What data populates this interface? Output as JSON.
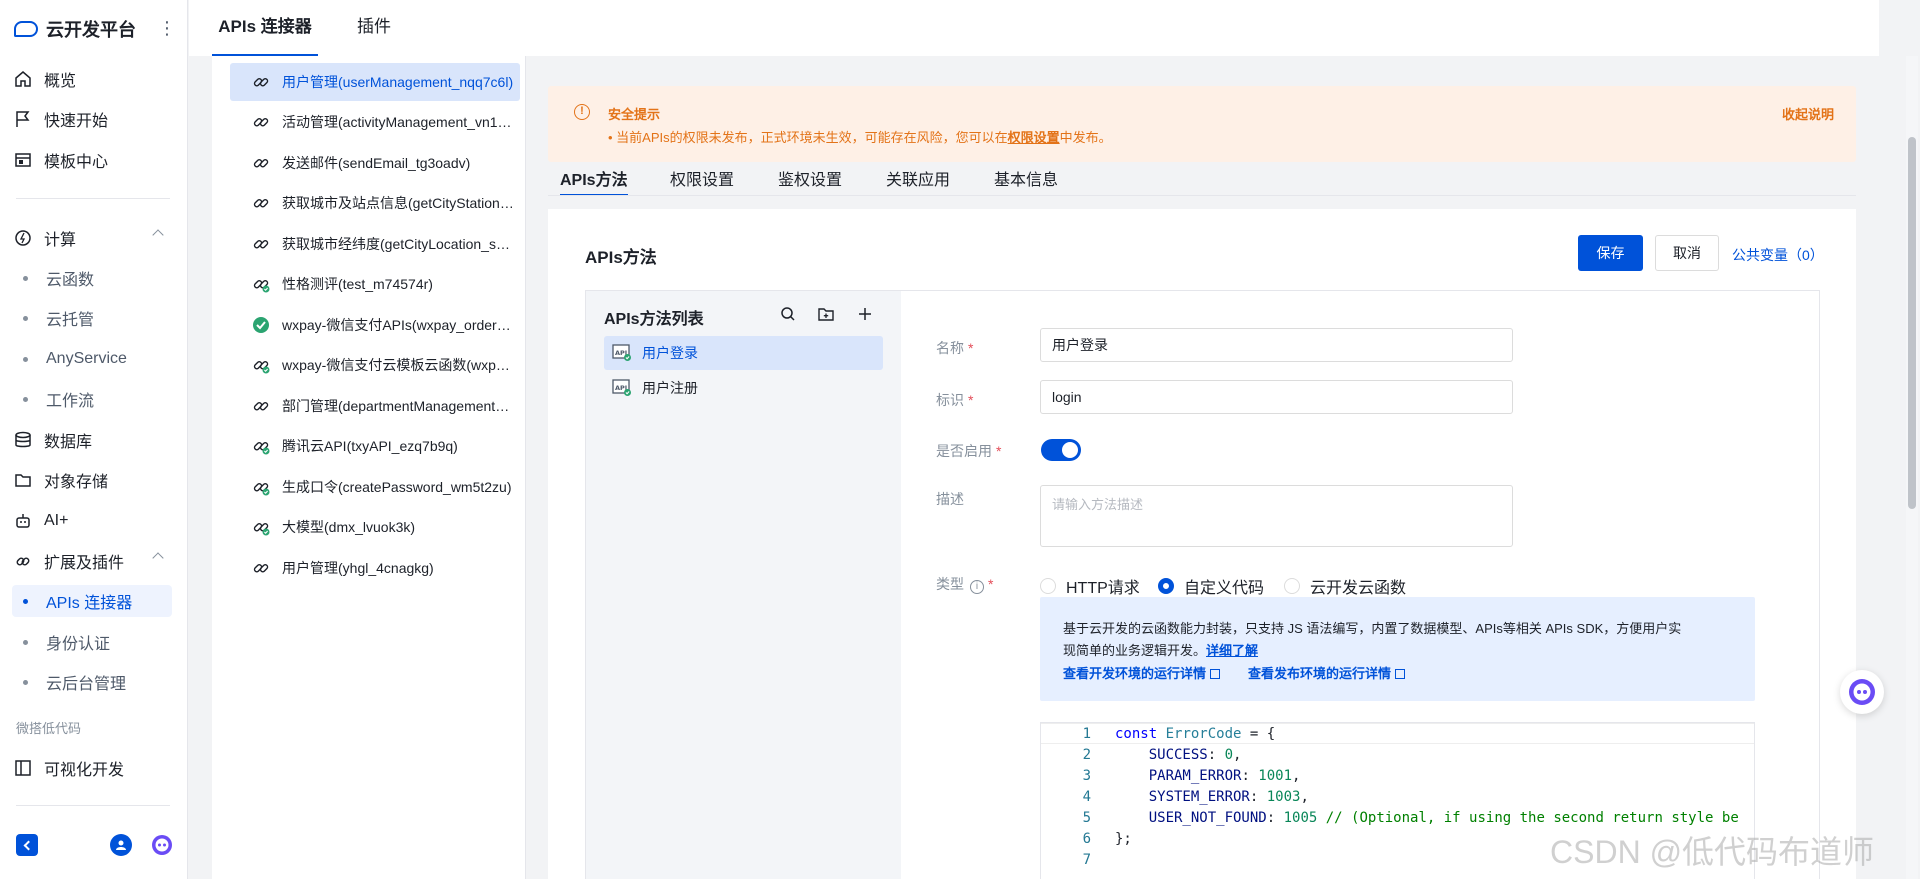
{
  "brand": {
    "title": "云开发平台"
  },
  "sidebar": {
    "nav": [
      {
        "label": "概览",
        "icon": "home-icon"
      },
      {
        "label": "快速开始",
        "icon": "flag-icon"
      },
      {
        "label": "模板中心",
        "icon": "template-icon"
      }
    ],
    "compute": {
      "label": "计算",
      "items": [
        "云函数",
        "云托管",
        "AnyService",
        "工作流"
      ]
    },
    "other": [
      {
        "label": "数据库",
        "icon": "database-icon"
      },
      {
        "label": "对象存储",
        "icon": "folder-icon"
      },
      {
        "label": "AI+",
        "icon": "robot-icon"
      }
    ],
    "extensions": {
      "label": "扩展及插件",
      "items": [
        "APIs 连接器",
        "身份认证",
        "云后台管理"
      ],
      "active": "APIs 连接器"
    },
    "lowcode_section": "微搭低代码",
    "lowcode_item": "可视化开发"
  },
  "topbar": {
    "tabs": [
      "APIs 连接器",
      "插件"
    ],
    "active": "APIs 连接器"
  },
  "api_list": [
    "用户管理(userManagement_nqq7c6l)",
    "活动管理(activityManagement_vn1p...",
    "发送邮件(sendEmail_tg3oadv)",
    "获取城市及站点信息(getCityStation_...",
    "获取城市经纬度(getCityLocation_sca...",
    "性格测评(test_m74574r)",
    "wxpay-微信支付APIs(wxpay_order_a...",
    "wxpay-微信支付云模板云函数(wxpay...",
    "部门管理(departmentManagement_a...",
    "腾讯云API(txyAPI_ezq7b9q)",
    "生成口令(createPassword_wm5t2zu)",
    "大模型(dmx_lvuok3k)",
    "用户管理(yhgl_4cnagkg)"
  ],
  "alert": {
    "title": "安全提示",
    "text_before": "• 当前APIs的权限未发布，正式环境未生效，可能存在风险，您可以在",
    "link": "权限设置",
    "text_after": "中发布。",
    "collapse": "收起说明"
  },
  "subtabs": [
    "APIs方法",
    "权限设置",
    "鉴权设置",
    "关联应用",
    "基本信息"
  ],
  "card": {
    "title": "APIs方法",
    "save": "保存",
    "cancel": "取消",
    "vars": "公共变量（0）"
  },
  "method_list": {
    "title": "APIs方法列表",
    "items": [
      "用户登录",
      "用户注册"
    ]
  },
  "form": {
    "name_label": "名称",
    "name_value": "用户登录",
    "id_label": "标识",
    "id_value": "login",
    "enabled_label": "是否启用",
    "desc_label": "描述",
    "desc_placeholder": "请输入方法描述",
    "type_label": "类型",
    "type_options": [
      "HTTP请求",
      "自定义代码",
      "云开发云函数"
    ],
    "type_selected": "自定义代码"
  },
  "info": {
    "line1": "基于云开发的云函数能力封装，只支持 JS 语法编写，内置了数据模型、APIs等相关 APIs SDK，方便用户实",
    "line2": "现简单的业务逻辑开发。",
    "more": "详细了解",
    "dev_link": "查看开发环境的运行详情",
    "prod_link": "查看发布环境的运行详情"
  },
  "code": {
    "lines": [
      {
        "n": "1",
        "t": "const ErrorCode = {"
      },
      {
        "n": "2",
        "t": "    SUCCESS: 0,"
      },
      {
        "n": "3",
        "t": "    PARAM_ERROR: 1001,"
      },
      {
        "n": "4",
        "t": "    SYSTEM_ERROR: 1003,"
      },
      {
        "n": "5",
        "t": "    USER_NOT_FOUND: 1005 // (Optional, if using the second return style be"
      },
      {
        "n": "6",
        "t": "};"
      },
      {
        "n": "7",
        "t": ""
      }
    ]
  },
  "watermark": "CSDN @低代码布道师",
  "colors": {
    "primary": "#0052d9",
    "warning": "#e37318",
    "warning_bg": "#fef0e6",
    "info_bg": "#e6efff"
  }
}
